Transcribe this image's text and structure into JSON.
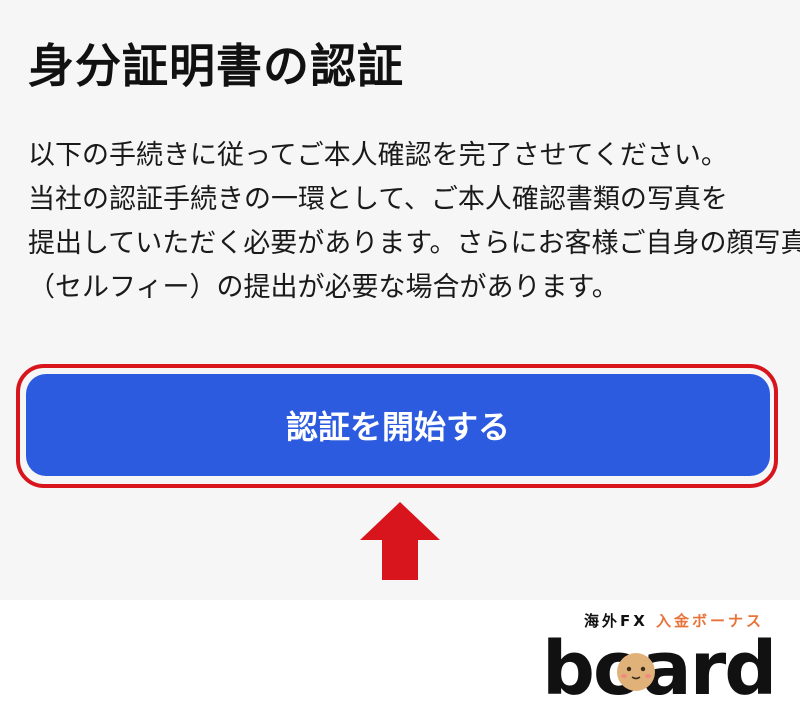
{
  "page": {
    "title": "身分証明書の認証",
    "description_lines": [
      "以下の手続きに従ってご本人確認を完了させてください。",
      "当社の認証手続きの一環として、ご本人確認書類の写真を",
      "提出していただく必要があります。さらにお客様ご自身の顔写真",
      "（セルフィー）の提出が必要な場合があります。"
    ],
    "start_button_label": "認証を開始する"
  },
  "colors": {
    "button": "#2c5be0",
    "highlight": "#d8141c",
    "arrow": "#d8141c",
    "brand_accent": "#e8743b"
  },
  "brand": {
    "tagline_prefix": "海外FX",
    "tagline_accent": "入金ボーナス",
    "wordmark": "board",
    "mascot_icon": "potato-mascot-icon"
  }
}
